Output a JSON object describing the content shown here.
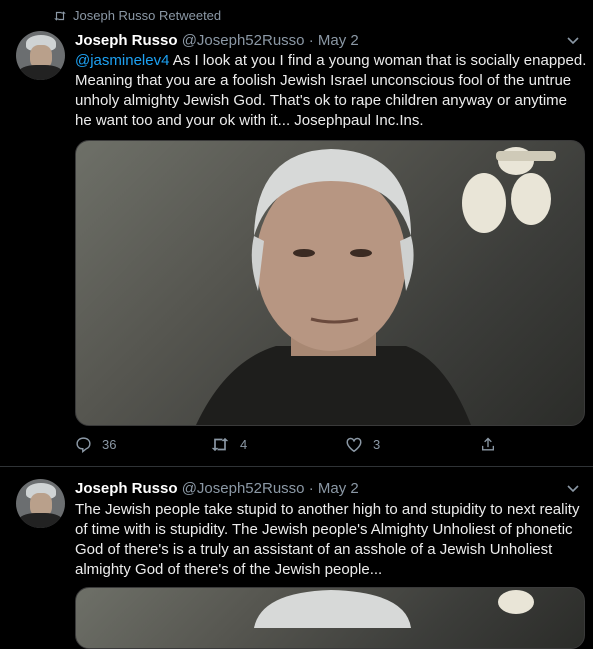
{
  "retweet_banner": "Joseph Russo Retweeted",
  "tweets": [
    {
      "name": "Joseph Russo",
      "handle": "@Joseph52Russo",
      "separator": "·",
      "date": "May 2",
      "mention": "@jasminelev4",
      "text": "As I look at you I find a young woman that is socially enapped. Meaning that you are a foolish Jewish Israel unconscious fool of the untrue unholy almighty Jewish God. That's ok to rape children anyway or anytime he want too and your ok with it... Josephpaul Inc.Ins.",
      "replies": "36",
      "retweets": "4",
      "likes": "3"
    },
    {
      "name": "Joseph Russo",
      "handle": "@Joseph52Russo",
      "separator": "·",
      "date": "May 2",
      "text": "The Jewish people take stupid to another high to and stupidity to next reality of time with is stupidity. The Jewish people's Almighty Unholiest of phonetic God of there's is a truly an assistant of an asshole of a Jewish Unholiest almighty God of there's of the Jewish people..."
    }
  ],
  "colors": {
    "background": "#000000",
    "accent": "#1da1f2",
    "muted": "#8b98a5"
  }
}
